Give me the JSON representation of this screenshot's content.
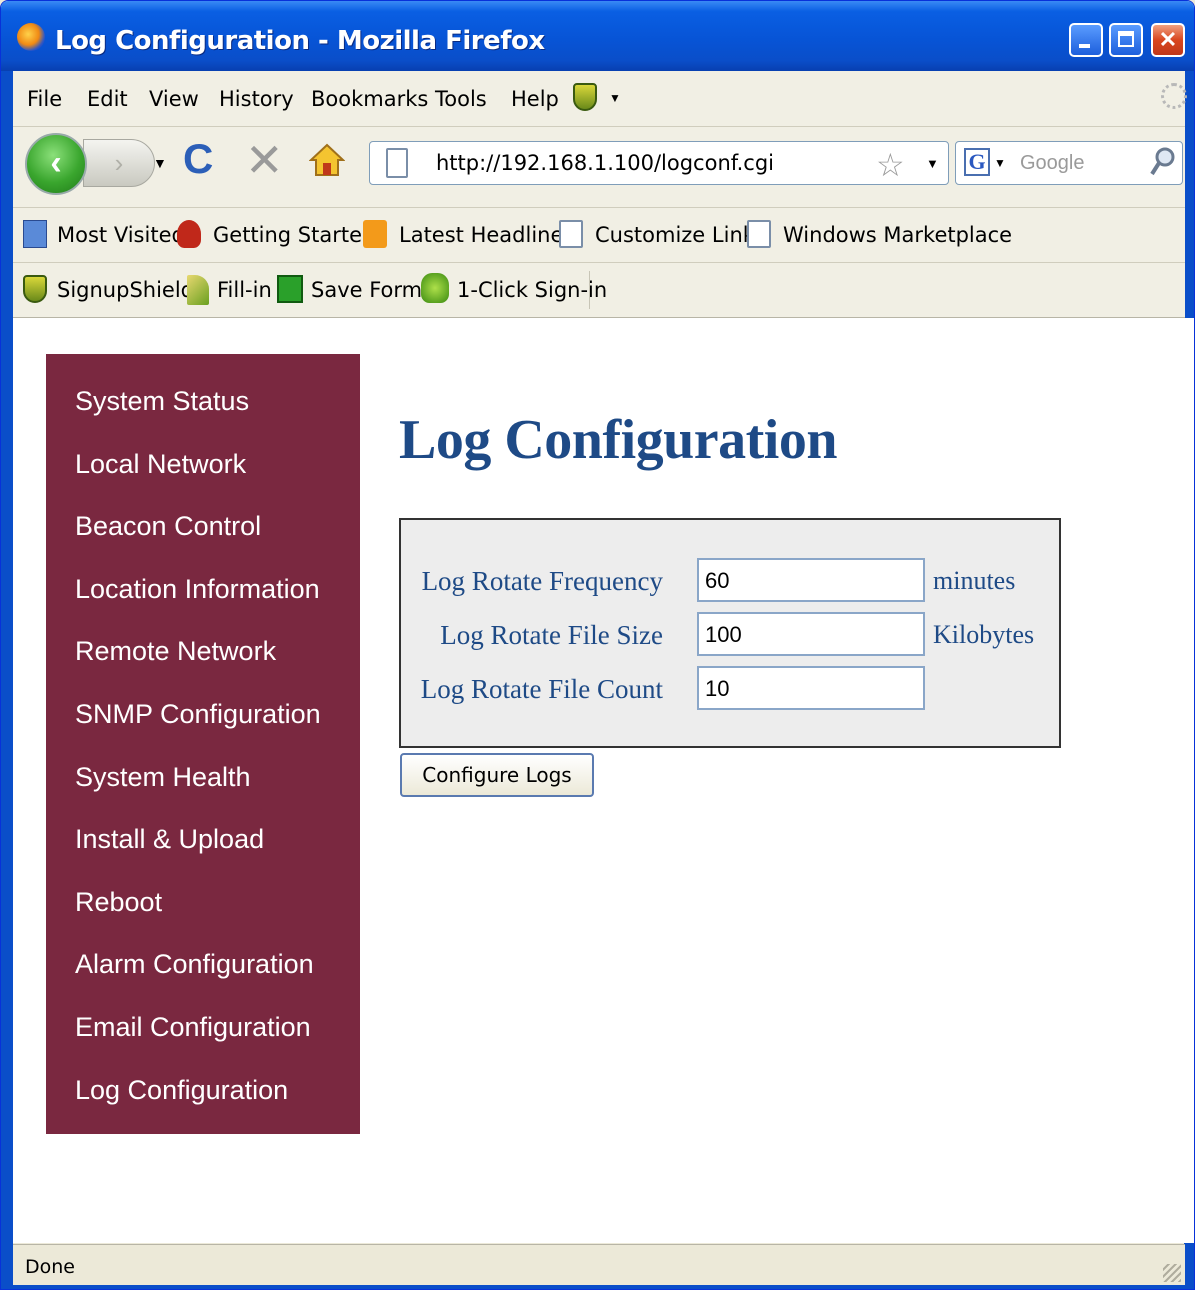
{
  "window": {
    "title": "Log Configuration - Mozilla Firefox"
  },
  "menubar": {
    "items": [
      "File",
      "Edit",
      "View",
      "History",
      "Bookmarks",
      "Tools",
      "Help"
    ]
  },
  "navbar": {
    "url": "http://192.168.1.100/logconf.cgi",
    "search_placeholder": "Google"
  },
  "bookmarks": {
    "items": [
      "Most Visited",
      "Getting Started",
      "Latest Headlines",
      "Customize Links",
      "Windows Marketplace"
    ]
  },
  "signup_toolbar": {
    "items": [
      "SignupShield",
      "Fill-in",
      "Save Form",
      "1-Click Sign-in"
    ]
  },
  "sidebar": {
    "items": [
      "System Status",
      "Local Network",
      "Beacon Control",
      "Location Information",
      "Remote Network",
      "SNMP Configuration",
      "System Health",
      "Install & Upload",
      "Reboot",
      "Alarm Configuration",
      "Email Configuration",
      "Log Configuration"
    ]
  },
  "main": {
    "title": "Log Configuration",
    "fields": [
      {
        "label": "Log Rotate Frequency",
        "value": "60",
        "unit": "minutes"
      },
      {
        "label": "Log Rotate File Size",
        "value": "100",
        "unit": "Kilobytes"
      },
      {
        "label": "Log Rotate File Count",
        "value": "10",
        "unit": ""
      }
    ],
    "submit_label": "Configure Logs"
  },
  "status": {
    "text": "Done"
  },
  "colors": {
    "sidebar_bg": "#7a2840",
    "title_color": "#1e4a86",
    "xp_blue": "#0a4ec9"
  }
}
